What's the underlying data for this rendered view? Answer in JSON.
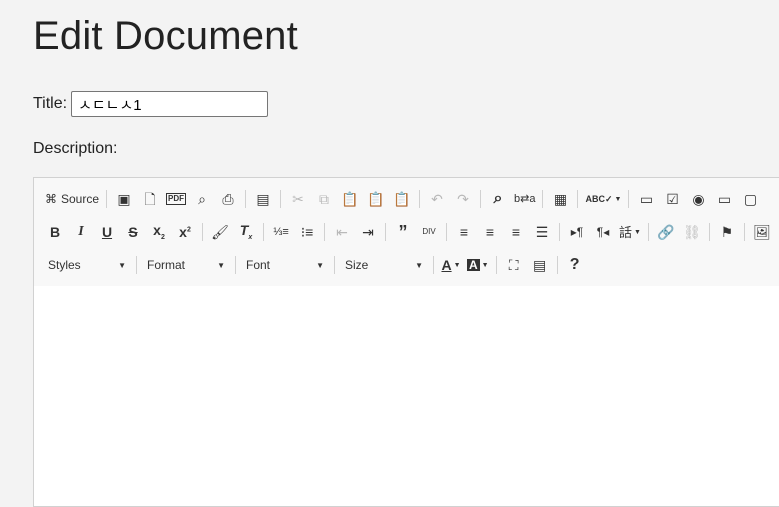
{
  "page": {
    "title": "Edit Document",
    "title_label": "Title:",
    "title_value": "ㅅㄷㄴㅅ1",
    "description_label": "Description:"
  },
  "toolbar": {
    "source_label": "Source",
    "combos": {
      "styles": "Styles",
      "format": "Format",
      "font": "Font",
      "size": "Size"
    }
  }
}
